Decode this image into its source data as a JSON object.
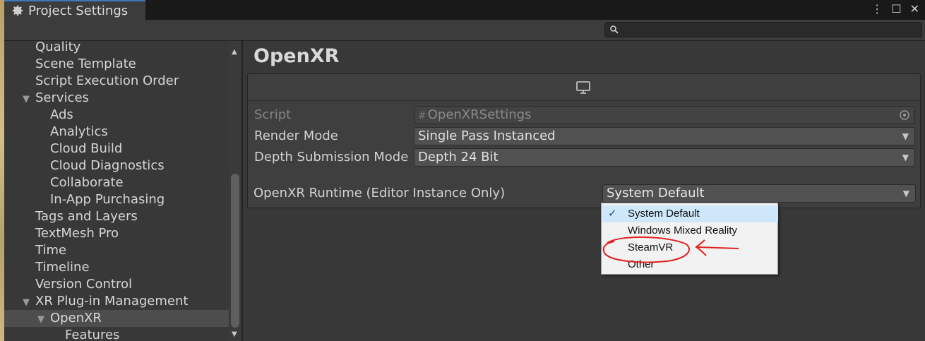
{
  "window": {
    "title": "Project Settings",
    "controls": [
      "⋮",
      "☐",
      "✕"
    ]
  },
  "search": {
    "placeholder": "",
    "value": ""
  },
  "sidebar": {
    "items": [
      {
        "label": "Quality",
        "indent": 1,
        "arrow": ""
      },
      {
        "label": "Scene Template",
        "indent": 1,
        "arrow": ""
      },
      {
        "label": "Script Execution Order",
        "indent": 1,
        "arrow": ""
      },
      {
        "label": "Services",
        "indent": 1,
        "arrow": "▼"
      },
      {
        "label": "Ads",
        "indent": 2,
        "arrow": ""
      },
      {
        "label": "Analytics",
        "indent": 2,
        "arrow": ""
      },
      {
        "label": "Cloud Build",
        "indent": 2,
        "arrow": ""
      },
      {
        "label": "Cloud Diagnostics",
        "indent": 2,
        "arrow": ""
      },
      {
        "label": "Collaborate",
        "indent": 2,
        "arrow": ""
      },
      {
        "label": "In-App Purchasing",
        "indent": 2,
        "arrow": ""
      },
      {
        "label": "Tags and Layers",
        "indent": 1,
        "arrow": ""
      },
      {
        "label": "TextMesh Pro",
        "indent": 1,
        "arrow": ""
      },
      {
        "label": "Time",
        "indent": 1,
        "arrow": ""
      },
      {
        "label": "Timeline",
        "indent": 1,
        "arrow": ""
      },
      {
        "label": "Version Control",
        "indent": 1,
        "arrow": ""
      },
      {
        "label": "XR Plug-in Management",
        "indent": 1,
        "arrow": "▼"
      },
      {
        "label": "OpenXR",
        "indent": 2,
        "arrow": "▼",
        "selected": true
      },
      {
        "label": "Features",
        "indent": 3,
        "arrow": ""
      }
    ]
  },
  "main": {
    "title": "OpenXR",
    "script": {
      "label": "Script",
      "value": "OpenXRSettings"
    },
    "render_mode": {
      "label": "Render Mode",
      "value": "Single Pass Instanced"
    },
    "depth_mode": {
      "label": "Depth Submission Mode",
      "value": "Depth 24 Bit"
    },
    "runtime": {
      "label": "OpenXR Runtime (Editor Instance Only)",
      "value": "System Default"
    }
  },
  "popup": {
    "options": [
      {
        "label": "System Default",
        "checked": true
      },
      {
        "label": "Windows Mixed Reality",
        "checked": false
      },
      {
        "label": "SteamVR",
        "checked": false
      },
      {
        "label": "Other",
        "checked": false
      }
    ]
  },
  "colors": {
    "accent": "#3a79bb",
    "annotation": "#e02020",
    "popup_check_bg": "#cfe7fb"
  }
}
